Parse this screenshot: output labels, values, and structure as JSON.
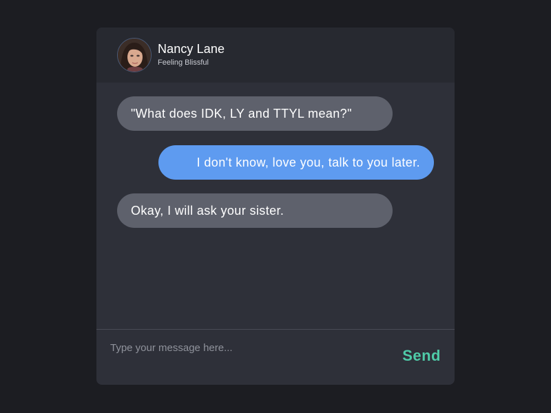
{
  "contact": {
    "name": "Nancy Lane",
    "status": "Feeling Blissful",
    "avatar_icon": "user-photo"
  },
  "messages": [
    {
      "direction": "incoming",
      "text": "\"What does IDK, LY and TTYL mean?\""
    },
    {
      "direction": "outgoing",
      "text": "I don't know, love you, talk to you later."
    },
    {
      "direction": "incoming",
      "text": "Okay, I will ask your sister."
    }
  ],
  "composer": {
    "placeholder": "Type your message here...",
    "value": "",
    "send_label": "Send"
  },
  "colors": {
    "background": "#1c1d22",
    "card": "#2e3039",
    "header": "#272930",
    "incoming_bubble": "#5e616c",
    "outgoing_bubble": "#5e9bf0",
    "send_accent": "#4fcba8"
  }
}
